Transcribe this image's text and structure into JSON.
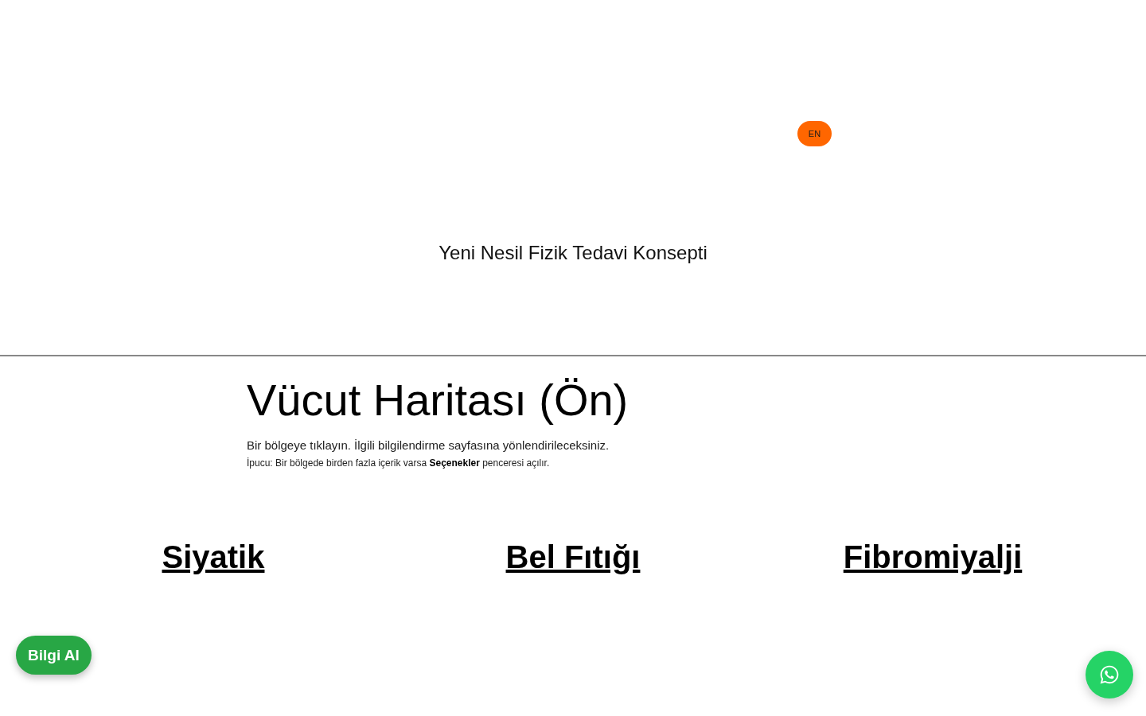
{
  "header": {
    "language_button": "EN",
    "tagline": "Yeni Nesil Fizik Tedavi Konsepti"
  },
  "body_map": {
    "title": "Vücut Haritası (Ön)",
    "instruction": "Bir bölgeye tıklayın. İlgili bilgilendirme sayfasına yönlendirileceksiniz.",
    "tip": "İpucu: Bir bölgede birden fazla içerik varsa **Seçenekler** penceresi açılır.",
    "regions": [
      {
        "label": "Siyatik"
      },
      {
        "label": "Bel Fıtığı"
      },
      {
        "label": "Fibromiyalji"
      }
    ]
  },
  "floating": {
    "info_button": "Bilgi Al"
  }
}
